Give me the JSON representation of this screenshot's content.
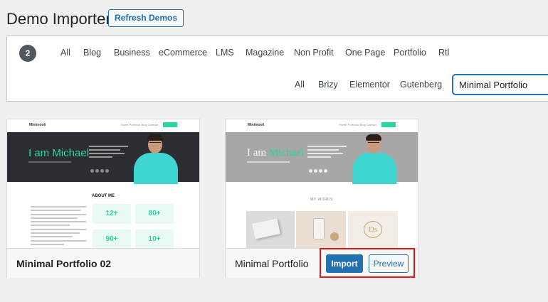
{
  "header": {
    "title": "Demo Importer",
    "refresh_label": "Refresh Demos"
  },
  "filters": {
    "count": "2",
    "categories": [
      "All",
      "Blog",
      "Business",
      "eCommerce",
      "LMS",
      "Magazine",
      "Non Profit",
      "One Page",
      "Portfolio",
      "Rtl"
    ],
    "builders": [
      "All",
      "Brizy",
      "Elementor",
      "Gutenberg"
    ],
    "search_value": "Minimal Portfolio"
  },
  "demos": [
    {
      "name": "Minimal Portfolio 02",
      "thumb": {
        "logo": "Minimooli",
        "nav": "Home  Portfolio  Blog  Contact",
        "hero_title": "I am Michael",
        "section_title": "ABOUT ME",
        "stats": [
          "12+",
          "80+",
          "90+",
          "10+"
        ]
      }
    },
    {
      "name": "Minimal Portfolio",
      "thumb": {
        "logo": "Minimooli",
        "nav": "Home  Portfolio  Blog  Contact",
        "hero_prefix": "I am ",
        "hero_name": "Michael",
        "section_title": "MY WORKS"
      },
      "actions": {
        "import_label": "Import",
        "preview_label": "Preview"
      }
    }
  ],
  "colors": {
    "accent": "#2271b1",
    "mint": "#2bd6a0",
    "highlight": "#e11111",
    "hero_dark": "#2b2d33",
    "hero_gray": "#a7a7a7"
  }
}
